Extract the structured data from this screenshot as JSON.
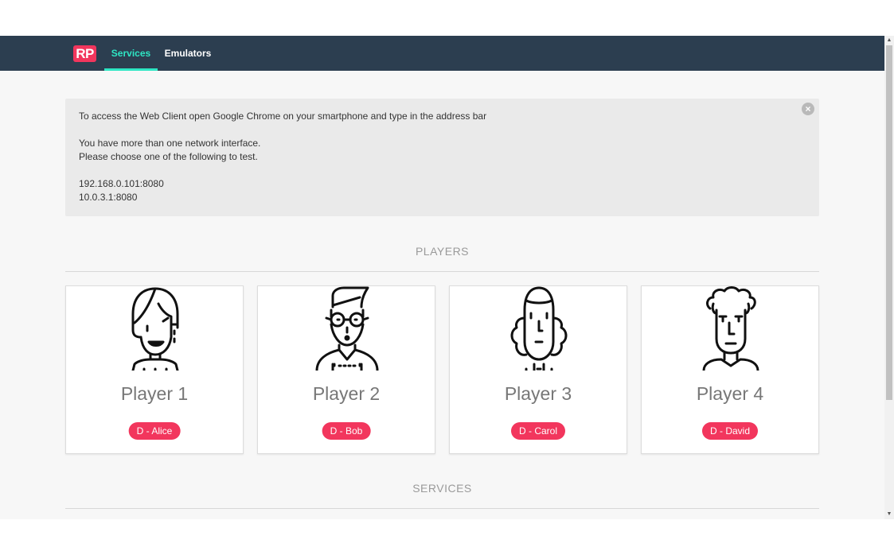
{
  "navbar": {
    "logo": "RP",
    "tabs": [
      {
        "label": "Services",
        "active": true
      },
      {
        "label": "Emulators",
        "active": false
      }
    ]
  },
  "info": {
    "line1": "To access the Web Client open Google Chrome on your smartphone and type in the address bar",
    "line2": "You have more than one network interface.",
    "line3": "Please choose one of the following to test.",
    "addresses": [
      "192.168.0.101:8080",
      "10.0.3.1:8080"
    ],
    "close_glyph": "×"
  },
  "sections": {
    "players": "PLAYERS",
    "services": "SERVICES"
  },
  "players": [
    {
      "name": "Player 1",
      "badge": "D - Alice",
      "avatar": "woman-avatar-icon"
    },
    {
      "name": "Player 2",
      "badge": "D - Bob",
      "avatar": "glasses-man-avatar-icon"
    },
    {
      "name": "Player 3",
      "badge": "D - Carol",
      "avatar": "curly-hair-avatar-icon"
    },
    {
      "name": "Player 4",
      "badge": "D - David",
      "avatar": "curly-top-man-avatar-icon"
    }
  ],
  "colors": {
    "navbar_bg": "#2c3e50",
    "accent": "#2ee6c4",
    "brand": "#f2365d"
  }
}
